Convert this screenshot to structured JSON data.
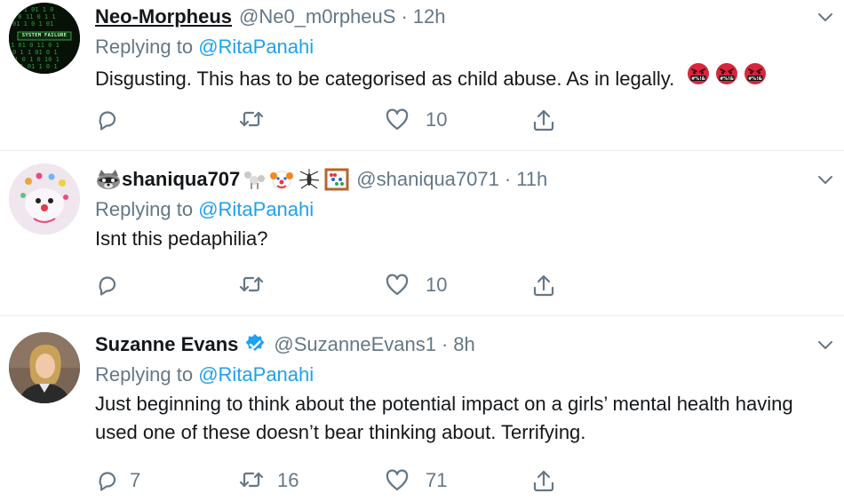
{
  "tweets": [
    {
      "name": "Neo-Morpheus",
      "handle": "@Ne0_m0rpheuS",
      "separator": "·",
      "time": "12h",
      "replying_prefix": "Replying to ",
      "replying_to": "@RitaPanahi",
      "text": "Disgusting. This has to be categorised as child abuse. As in legally.",
      "emojis": [
        "face-with-symbols-icon",
        "face-with-symbols-icon",
        "face-with-symbols-icon"
      ],
      "avatar_text": "SYSTEM FAILURE",
      "reply_count": "",
      "retweet_count": "",
      "like_count": "10"
    },
    {
      "name": "shaniqua707",
      "name_prefix_emoji": "raccoon-icon",
      "name_suffix_emojis": [
        "poodle-icon",
        "clown-face-icon",
        "mosquito-icon",
        "abacus-icon"
      ],
      "handle": "@shaniqua7071",
      "separator": "·",
      "time": "11h",
      "replying_prefix": "Replying to ",
      "replying_to": "@RitaPanahi",
      "text": "Isnt this pedaphilia?",
      "reply_count": "",
      "retweet_count": "",
      "like_count": "10"
    },
    {
      "name": "Suzanne Evans",
      "verified": true,
      "handle": "@SuzanneEvans1",
      "separator": "·",
      "time": "8h",
      "replying_prefix": "Replying to ",
      "replying_to": "@RitaPanahi",
      "text": "Just beginning to think about the potential impact on a girls’ mental health having used one of these doesn’t bear thinking about. Terrifying.",
      "reply_count": "7",
      "retweet_count": "16",
      "like_count": "71"
    }
  ],
  "colors": {
    "link": "#1da1f2",
    "secondary": "#657786",
    "primary": "#14171a",
    "divider": "#e6ecf0",
    "verified": "#1da1f2"
  }
}
